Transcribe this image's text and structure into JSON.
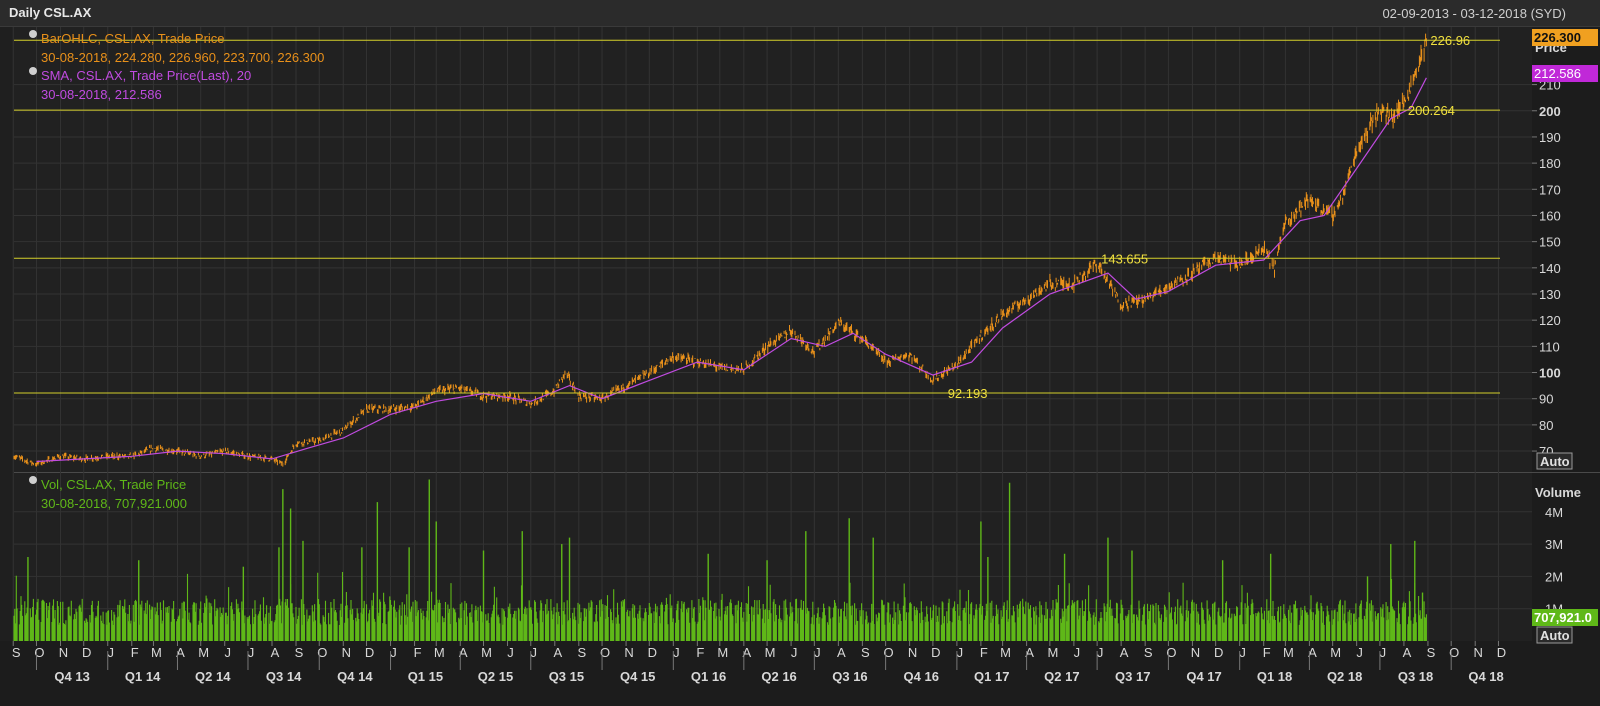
{
  "window": {
    "title": "Daily CSL.AX",
    "date_range": "02-09-2013 - 03-12-2018 (SYD)"
  },
  "colors": {
    "background": "#222222",
    "grid": "#333333",
    "price_bars": "#e8901a",
    "sma_line": "#c04be0",
    "volume_bars": "#5fb818",
    "reference_lines": "#d4cf2a",
    "legend_price": "#e8901a",
    "legend_sma": "#c04be0",
    "legend_volume": "#5fb818"
  },
  "legend": {
    "price_series": "BarOHLC, CSL.AX, Trade Price",
    "price_values": "30-08-2018, 224.280, 226.960, 223.700, 226.300",
    "sma_series": "SMA, CSL.AX, Trade Price(Last),  20",
    "sma_values": "30-08-2018, 212.586",
    "volume_series": "Vol, CSL.AX, Trade Price",
    "volume_values": "30-08-2018, 707,921.000"
  },
  "badges": {
    "last_price": "226.300",
    "sma_last": "212.586",
    "volume_last": "707,921.0",
    "auto_price": "Auto",
    "auto_volume": "Auto"
  },
  "chart_data": [
    {
      "type": "line",
      "subtype": "ohlc",
      "title": "",
      "ylabel": "Price",
      "ylim": [
        62,
        232
      ],
      "y_ticks": [
        70,
        80,
        90,
        100,
        110,
        120,
        130,
        140,
        150,
        160,
        170,
        180,
        190,
        200,
        210
      ],
      "x_range": [
        "2013-09-02",
        "2018-12-03"
      ],
      "series": [
        {
          "name": "BarOHLC, CSL.AX, Trade Price",
          "points": [
            [
              "2013-09-02",
              68
            ],
            [
              "2013-10-01",
              65
            ],
            [
              "2013-11-01",
              68
            ],
            [
              "2013-12-01",
              67
            ],
            [
              "2014-01-01",
              68
            ],
            [
              "2014-02-01",
              68
            ],
            [
              "2014-03-01",
              71
            ],
            [
              "2014-04-01",
              70
            ],
            [
              "2014-05-01",
              68
            ],
            [
              "2014-06-01",
              70
            ],
            [
              "2014-07-01",
              68
            ],
            [
              "2014-08-01",
              67
            ],
            [
              "2014-08-15",
              65
            ],
            [
              "2014-09-01",
              73
            ],
            [
              "2014-10-01",
              74
            ],
            [
              "2014-11-01",
              78
            ],
            [
              "2014-12-01",
              86
            ],
            [
              "2015-01-01",
              86
            ],
            [
              "2015-02-01",
              87
            ],
            [
              "2015-03-01",
              93
            ],
            [
              "2015-04-01",
              94
            ],
            [
              "2015-05-01",
              91
            ],
            [
              "2015-06-01",
              91
            ],
            [
              "2015-07-01",
              88
            ],
            [
              "2015-08-01",
              93
            ],
            [
              "2015-08-15",
              100
            ],
            [
              "2015-09-01",
              91
            ],
            [
              "2015-10-01",
              90
            ],
            [
              "2015-11-01",
              95
            ],
            [
              "2015-12-01",
              100
            ],
            [
              "2016-01-01",
              106
            ],
            [
              "2016-02-01",
              104
            ],
            [
              "2016-03-01",
              102
            ],
            [
              "2016-04-01",
              101
            ],
            [
              "2016-05-01",
              110
            ],
            [
              "2016-06-01",
              116
            ],
            [
              "2016-07-01",
              108
            ],
            [
              "2016-08-01",
              119
            ],
            [
              "2016-09-01",
              113
            ],
            [
              "2016-10-01",
              104
            ],
            [
              "2016-11-01",
              107
            ],
            [
              "2016-12-01",
              97
            ],
            [
              "2017-01-01",
              103
            ],
            [
              "2017-02-01",
              114
            ],
            [
              "2017-03-01",
              122
            ],
            [
              "2017-04-01",
              128
            ],
            [
              "2017-05-01",
              134
            ],
            [
              "2017-06-01",
              134
            ],
            [
              "2017-07-01",
              142
            ],
            [
              "2017-08-01",
              126
            ],
            [
              "2017-09-01",
              128
            ],
            [
              "2017-10-01",
              133
            ],
            [
              "2017-11-01",
              138
            ],
            [
              "2017-12-01",
              144
            ],
            [
              "2018-01-01",
              141
            ],
            [
              "2018-02-01",
              147
            ],
            [
              "2018-02-15",
              140
            ],
            [
              "2018-03-01",
              158
            ],
            [
              "2018-04-01",
              166
            ],
            [
              "2018-05-01",
              160
            ],
            [
              "2018-05-15",
              168
            ],
            [
              "2018-06-01",
              185
            ],
            [
              "2018-07-01",
              201
            ],
            [
              "2018-07-15",
              197
            ],
            [
              "2018-08-01",
              203
            ],
            [
              "2018-08-15",
              214
            ],
            [
              "2018-08-30",
              226.3
            ]
          ]
        },
        {
          "name": "SMA, CSL.AX, Trade Price(Last),  20",
          "points": [
            [
              "2013-10-01",
              66
            ],
            [
              "2013-12-01",
              67
            ],
            [
              "2014-02-01",
              68
            ],
            [
              "2014-04-01",
              70
            ],
            [
              "2014-06-01",
              69
            ],
            [
              "2014-08-01",
              67
            ],
            [
              "2014-09-15",
              71
            ],
            [
              "2014-11-01",
              75
            ],
            [
              "2015-01-01",
              84
            ],
            [
              "2015-03-01",
              89
            ],
            [
              "2015-05-01",
              92
            ],
            [
              "2015-07-01",
              89
            ],
            [
              "2015-08-20",
              95
            ],
            [
              "2015-10-01",
              90
            ],
            [
              "2015-12-01",
              97
            ],
            [
              "2016-02-01",
              104
            ],
            [
              "2016-04-01",
              101
            ],
            [
              "2016-06-01",
              113
            ],
            [
              "2016-07-15",
              110
            ],
            [
              "2016-08-20",
              115
            ],
            [
              "2016-10-01",
              107
            ],
            [
              "2016-12-01",
              99
            ],
            [
              "2017-01-20",
              104
            ],
            [
              "2017-03-01",
              117
            ],
            [
              "2017-05-01",
              130
            ],
            [
              "2017-07-15",
              138
            ],
            [
              "2017-08-20",
              128
            ],
            [
              "2017-10-01",
              131
            ],
            [
              "2017-12-01",
              141
            ],
            [
              "2018-02-01",
              143
            ],
            [
              "2018-03-20",
              158
            ],
            [
              "2018-04-20",
              160
            ],
            [
              "2018-06-01",
              178
            ],
            [
              "2018-07-15",
              197
            ],
            [
              "2018-08-10",
              201
            ],
            [
              "2018-08-30",
              212.586
            ]
          ]
        }
      ],
      "horizontal_lines": [
        {
          "value": 226.96,
          "label": "226.96"
        },
        {
          "value": 200.264,
          "label": "200.264"
        },
        {
          "value": 143.655,
          "label": "143.655"
        },
        {
          "value": 92.193,
          "label": "92.193"
        }
      ],
      "annotations": [
        {
          "date": "2018-08-30",
          "value": 226.96,
          "label": "226.96"
        },
        {
          "date": "2018-08-01",
          "value": 200.264,
          "label": "200.264"
        },
        {
          "date": "2017-07-01",
          "value": 143.655,
          "label": "143.655"
        },
        {
          "date": "2016-12-15",
          "value": 92.193,
          "label": "92.193"
        }
      ],
      "grid": true
    },
    {
      "type": "bar",
      "title": "",
      "ylabel": "Volume",
      "ylim": [
        0,
        5200000
      ],
      "y_ticks": [
        {
          "value": 1000000,
          "label": "1M"
        },
        {
          "value": 2000000,
          "label": "2M"
        },
        {
          "value": 3000000,
          "label": "3M"
        },
        {
          "value": 4000000,
          "label": "4M"
        }
      ],
      "series": [
        {
          "name": "Vol, CSL.AX, Trade Price",
          "typical": 900000,
          "spikes": [
            [
              "2013-09-20",
              2600000
            ],
            [
              "2014-02-10",
              2500000
            ],
            [
              "2014-06-25",
              2300000
            ],
            [
              "2014-08-10",
              2900000
            ],
            [
              "2014-08-15",
              4700000
            ],
            [
              "2014-08-25",
              4100000
            ],
            [
              "2014-09-10",
              3100000
            ],
            [
              "2014-11-25",
              2900000
            ],
            [
              "2014-12-15",
              4300000
            ],
            [
              "2015-01-25",
              2900000
            ],
            [
              "2015-02-20",
              5000000
            ],
            [
              "2015-03-01",
              3700000
            ],
            [
              "2015-05-01",
              2800000
            ],
            [
              "2015-06-20",
              3400000
            ],
            [
              "2015-08-10",
              3000000
            ],
            [
              "2015-08-20",
              3200000
            ],
            [
              "2016-02-15",
              2700000
            ],
            [
              "2016-05-01",
              2500000
            ],
            [
              "2016-06-20",
              3400000
            ],
            [
              "2016-08-15",
              3800000
            ],
            [
              "2016-09-15",
              3200000
            ],
            [
              "2017-02-01",
              3700000
            ],
            [
              "2017-02-10",
              2600000
            ],
            [
              "2017-03-10",
              4900000
            ],
            [
              "2017-05-20",
              2700000
            ],
            [
              "2017-07-15",
              3200000
            ],
            [
              "2017-08-15",
              2800000
            ],
            [
              "2017-12-10",
              2500000
            ],
            [
              "2018-02-10",
              2700000
            ],
            [
              "2018-06-15",
              2000000
            ],
            [
              "2018-07-15",
              3000000
            ],
            [
              "2018-08-15",
              3100000
            ],
            [
              "2018-08-25",
              1500000
            ]
          ],
          "last": [
            "2018-08-30",
            707921
          ]
        }
      ],
      "grid": true
    }
  ],
  "x_axis": {
    "months": [
      "S",
      "O",
      "N",
      "D",
      "J",
      "F",
      "M",
      "A",
      "M",
      "J",
      "J",
      "A",
      "S",
      "O",
      "N",
      "D",
      "J",
      "F",
      "M",
      "A",
      "M",
      "J",
      "J",
      "A",
      "S",
      "O",
      "N",
      "D",
      "J",
      "F",
      "M",
      "A",
      "M",
      "J",
      "J",
      "A",
      "S",
      "O",
      "N",
      "D",
      "J",
      "F",
      "M",
      "A",
      "M",
      "J",
      "J",
      "A",
      "S",
      "O",
      "N",
      "D",
      "J",
      "F",
      "M",
      "A",
      "M",
      "J",
      "J",
      "A",
      "S",
      "O",
      "N",
      "D"
    ],
    "quarters": [
      "Q4 13",
      "Q1 14",
      "Q2 14",
      "Q3 14",
      "Q4 14",
      "Q1 15",
      "Q2 15",
      "Q3 15",
      "Q4 15",
      "Q1 16",
      "Q2 16",
      "Q3 16",
      "Q4 16",
      "Q1 17",
      "Q2 17",
      "Q3 17",
      "Q4 17",
      "Q1 18",
      "Q2 18",
      "Q3 18",
      "Q4 18"
    ]
  },
  "axis_labels": {
    "price": "Price",
    "volume": "Volume"
  }
}
